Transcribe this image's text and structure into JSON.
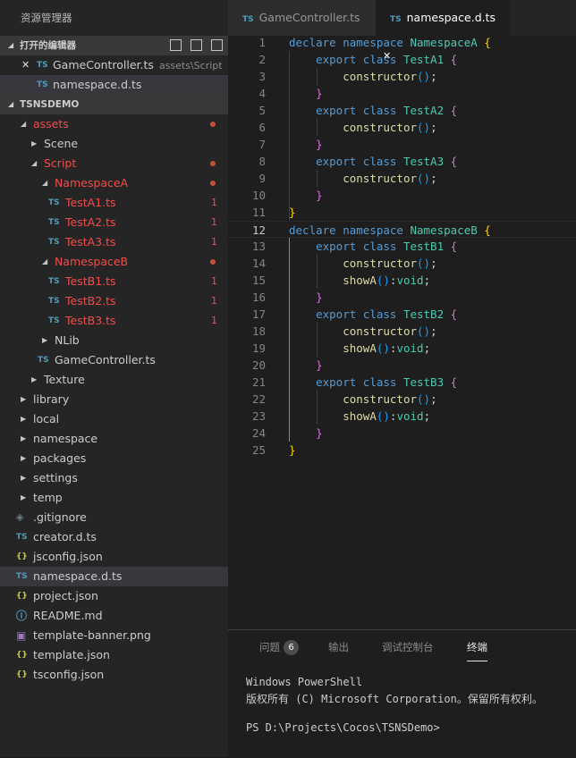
{
  "sidebar": {
    "title": "资源管理器",
    "open_editors": {
      "header": "打开的编辑器",
      "items": [
        {
          "icon": "TS",
          "label": "GameController.ts",
          "desc": "assets\\Script",
          "has_close": true
        },
        {
          "icon": "TS",
          "label": "namespace.d.ts",
          "desc": "",
          "has_close": false
        }
      ]
    },
    "project": {
      "header": "TSNSDEMO",
      "items": [
        {
          "label": "assets",
          "icon": "",
          "twisty": "▲",
          "modified": true
        },
        {
          "label": "Scene",
          "icon": "",
          "twisty": "▶"
        },
        {
          "label": "Script",
          "icon": "",
          "twisty": "▲",
          "modified": true
        },
        {
          "label": "NamespaceA",
          "icon": "",
          "twisty": "▲",
          "modified": true
        },
        {
          "label": "TestA1.ts",
          "icon": "TS",
          "count": "1"
        },
        {
          "label": "TestA2.ts",
          "icon": "TS",
          "count": "1"
        },
        {
          "label": "TestA3.ts",
          "icon": "TS",
          "count": "1"
        },
        {
          "label": "NamespaceB",
          "icon": "",
          "twisty": "▲",
          "modified": true
        },
        {
          "label": "TestB1.ts",
          "icon": "TS",
          "count": "1"
        },
        {
          "label": "TestB2.ts",
          "icon": "TS",
          "count": "1"
        },
        {
          "label": "TestB3.ts",
          "icon": "TS",
          "count": "1"
        },
        {
          "label": "NLib",
          "icon": "",
          "twisty": "▶"
        },
        {
          "label": "GameController.ts",
          "icon": "TS"
        },
        {
          "label": "Texture",
          "icon": "",
          "twisty": "▶"
        },
        {
          "label": "library",
          "icon": "",
          "twisty": "▶"
        },
        {
          "label": "local",
          "icon": "",
          "twisty": "▶"
        },
        {
          "label": "namespace",
          "icon": "",
          "twisty": "▶"
        },
        {
          "label": "packages",
          "icon": "",
          "twisty": "▶"
        },
        {
          "label": "settings",
          "icon": "",
          "twisty": "▶"
        },
        {
          "label": "temp",
          "icon": "",
          "twisty": "▶"
        },
        {
          "label": ".gitignore",
          "icon": "◈"
        },
        {
          "label": "creator.d.ts",
          "icon": "TS"
        },
        {
          "label": "jsconfig.json",
          "icon": "{}"
        },
        {
          "label": "namespace.d.ts",
          "icon": "TS"
        },
        {
          "label": "project.json",
          "icon": "{}"
        },
        {
          "label": "README.md",
          "icon": "ⓘ"
        },
        {
          "label": "template-banner.png",
          "icon": "▣"
        },
        {
          "label": "template.json",
          "icon": "{}"
        },
        {
          "label": "tsconfig.json",
          "icon": "{}"
        }
      ]
    }
  },
  "tabs": [
    {
      "icon": "TS",
      "label": "GameController.ts",
      "active": false
    },
    {
      "icon": "TS",
      "label": "namespace.d.ts",
      "active": true,
      "close": "✕"
    }
  ],
  "editor": {
    "current_line": 12,
    "lines": [
      [
        [
          "k",
          "declare "
        ],
        [
          "k",
          "namespace "
        ],
        [
          "ty",
          "NamespaceA "
        ],
        [
          "b1",
          "{"
        ]
      ],
      [
        [
          "p",
          "    "
        ],
        [
          "k",
          "export "
        ],
        [
          "k",
          "class "
        ],
        [
          "ty",
          "TestA1 "
        ],
        [
          "b2",
          "{"
        ]
      ],
      [
        [
          "p",
          "        "
        ],
        [
          "f",
          "constructor"
        ],
        [
          "b3",
          "()"
        ],
        [
          "p",
          ";"
        ]
      ],
      [
        [
          "p",
          "    "
        ],
        [
          "b2",
          "}"
        ]
      ],
      [
        [
          "p",
          "    "
        ],
        [
          "k",
          "export "
        ],
        [
          "k",
          "class "
        ],
        [
          "ty",
          "TestA2 "
        ],
        [
          "b2",
          "{"
        ]
      ],
      [
        [
          "p",
          "        "
        ],
        [
          "f",
          "constructor"
        ],
        [
          "b3",
          "()"
        ],
        [
          "p",
          ";"
        ]
      ],
      [
        [
          "p",
          "    "
        ],
        [
          "b2",
          "}"
        ]
      ],
      [
        [
          "p",
          "    "
        ],
        [
          "k",
          "export "
        ],
        [
          "k",
          "class "
        ],
        [
          "ty",
          "TestA3 "
        ],
        [
          "b2",
          "{"
        ]
      ],
      [
        [
          "p",
          "        "
        ],
        [
          "f",
          "constructor"
        ],
        [
          "b3",
          "()"
        ],
        [
          "p",
          ";"
        ]
      ],
      [
        [
          "p",
          "    "
        ],
        [
          "b2",
          "}"
        ]
      ],
      [
        [
          "b1",
          "}"
        ]
      ],
      [
        [
          "k",
          "declare "
        ],
        [
          "k",
          "namespace "
        ],
        [
          "ty",
          "NamespaceB "
        ],
        [
          "b1",
          "{"
        ]
      ],
      [
        [
          "p",
          "    "
        ],
        [
          "k",
          "export "
        ],
        [
          "k",
          "class "
        ],
        [
          "ty",
          "TestB1 "
        ],
        [
          "b2",
          "{"
        ]
      ],
      [
        [
          "p",
          "        "
        ],
        [
          "f",
          "constructor"
        ],
        [
          "b3",
          "()"
        ],
        [
          "p",
          ";"
        ]
      ],
      [
        [
          "p",
          "        "
        ],
        [
          "f",
          "showA"
        ],
        [
          "b3",
          "()"
        ],
        [
          "p",
          ":"
        ],
        [
          "ty",
          "void"
        ],
        [
          "p",
          ";"
        ]
      ],
      [
        [
          "p",
          "    "
        ],
        [
          "b2",
          "}"
        ]
      ],
      [
        [
          "p",
          "    "
        ],
        [
          "k",
          "export "
        ],
        [
          "k",
          "class "
        ],
        [
          "ty",
          "TestB2 "
        ],
        [
          "b2",
          "{"
        ]
      ],
      [
        [
          "p",
          "        "
        ],
        [
          "f",
          "constructor"
        ],
        [
          "b3",
          "()"
        ],
        [
          "p",
          ";"
        ]
      ],
      [
        [
          "p",
          "        "
        ],
        [
          "f",
          "showA"
        ],
        [
          "b3",
          "()"
        ],
        [
          "p",
          ":"
        ],
        [
          "ty",
          "void"
        ],
        [
          "p",
          ";"
        ]
      ],
      [
        [
          "p",
          "    "
        ],
        [
          "b2",
          "}"
        ]
      ],
      [
        [
          "p",
          "    "
        ],
        [
          "k",
          "export "
        ],
        [
          "k",
          "class "
        ],
        [
          "ty",
          "TestB3 "
        ],
        [
          "b2",
          "{"
        ]
      ],
      [
        [
          "p",
          "        "
        ],
        [
          "f",
          "constructor"
        ],
        [
          "b3",
          "()"
        ],
        [
          "p",
          ";"
        ]
      ],
      [
        [
          "p",
          "        "
        ],
        [
          "f",
          "showA"
        ],
        [
          "b3",
          "()"
        ],
        [
          "p",
          ":"
        ],
        [
          "ty",
          "void"
        ],
        [
          "p",
          ";"
        ]
      ],
      [
        [
          "p",
          "    "
        ],
        [
          "b2",
          "}"
        ]
      ],
      [
        [
          "b1",
          "}"
        ]
      ]
    ]
  },
  "panel": {
    "tabs": [
      {
        "label": "问题",
        "badge": "6"
      },
      {
        "label": "输出"
      },
      {
        "label": "调试控制台"
      },
      {
        "label": "终端",
        "active": true
      }
    ],
    "terminal": [
      "Windows PowerShell",
      "版权所有 (C) Microsoft Corporation。保留所有权利。",
      "",
      "PS D:\\Projects\\Cocos\\TSNSDemo>"
    ]
  },
  "colors": {
    "accent": "#519aba",
    "error": "#f14c4c",
    "json": "#cbcb41"
  }
}
